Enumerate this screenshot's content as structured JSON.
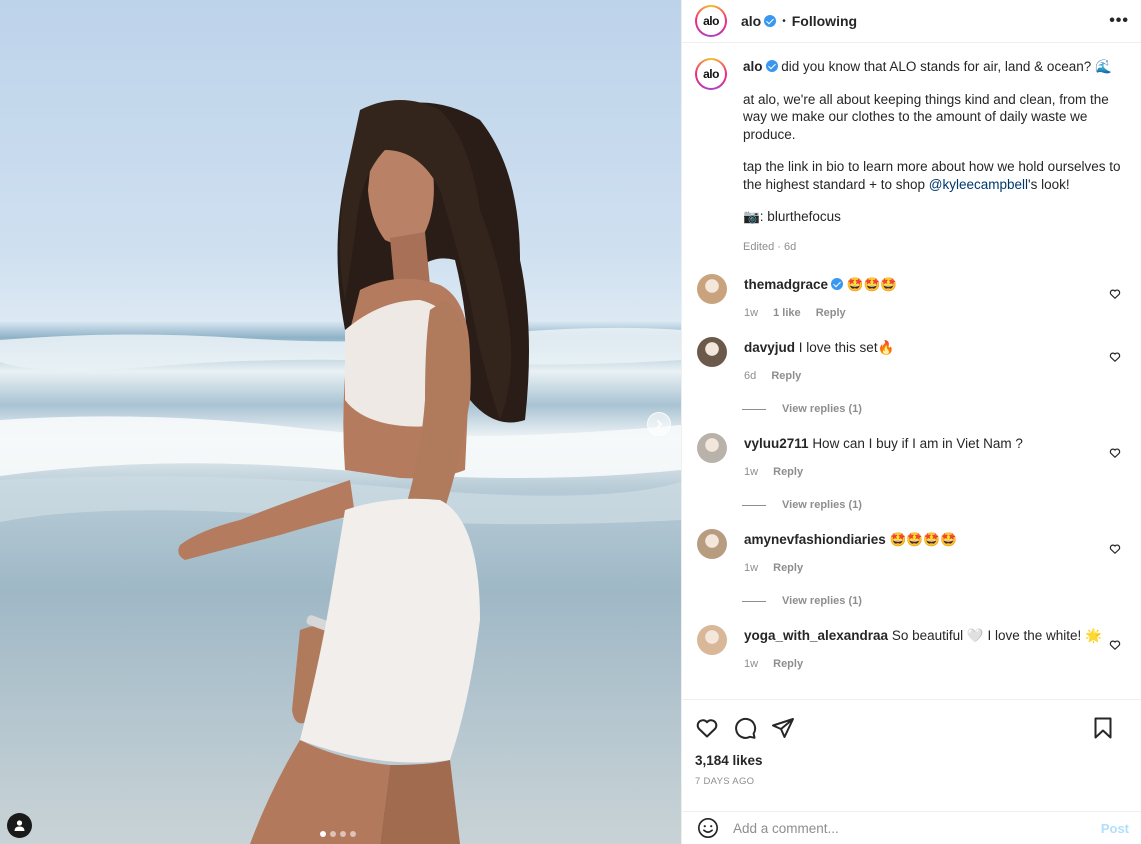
{
  "post": {
    "username": "alo",
    "follow_status": "Following",
    "separator": "•",
    "more_label": "•••",
    "logo_text": "alo"
  },
  "caption": {
    "username": "alo",
    "line1": "did you know that ALO stands for air, land & ocean? 🌊",
    "para2": "at alo, we're all about keeping things kind and clean, from the way we make our clothes to the amount of daily waste we produce.",
    "para3_a": "tap the link in bio to learn more about how we hold ourselves to the highest standard + to shop ",
    "para3_mention": "@kyleecampbell",
    "para3_b": "'s look!",
    "para4": "📷: blurthefocus",
    "meta": "Edited · 6d"
  },
  "comments": [
    {
      "username": "themadgrace",
      "verified": true,
      "text": "🤩🤩🤩",
      "time": "1w",
      "likes": "1 like",
      "reply": "Reply",
      "view_replies": "",
      "avatar_color": "#c9a27e"
    },
    {
      "username": "davyjud",
      "verified": false,
      "text": "I love this set🔥",
      "time": "6d",
      "likes": "",
      "reply": "Reply",
      "view_replies": "View replies (1)",
      "avatar_color": "#6b5a4c"
    },
    {
      "username": "vyluu2711",
      "verified": false,
      "text": "How can I buy if I am in Viet Nam ?",
      "time": "1w",
      "likes": "",
      "reply": "Reply",
      "view_replies": "View replies (1)",
      "avatar_color": "#b9b2aa"
    },
    {
      "username": "amynevfashiondiaries",
      "verified": false,
      "text": "🤩🤩🤩🤩",
      "time": "1w",
      "likes": "",
      "reply": "Reply",
      "view_replies": "View replies (1)",
      "avatar_color": "#b89c80"
    },
    {
      "username": "yoga_with_alexandraa",
      "verified": false,
      "text": "So beautiful 🤍 I love the white! 🌟",
      "time": "1w",
      "likes": "",
      "reply": "Reply",
      "view_replies": "",
      "avatar_color": "#d8b898"
    }
  ],
  "actions": {
    "likes": "3,184 likes",
    "posted_ago": "7 DAYS AGO",
    "comment_placeholder": "Add a comment...",
    "post_label": "Post"
  },
  "colors": {
    "link": "#00376b",
    "verified": "#3897f0",
    "muted": "#8e8e8e",
    "post_disabled": "#b2dffc"
  }
}
